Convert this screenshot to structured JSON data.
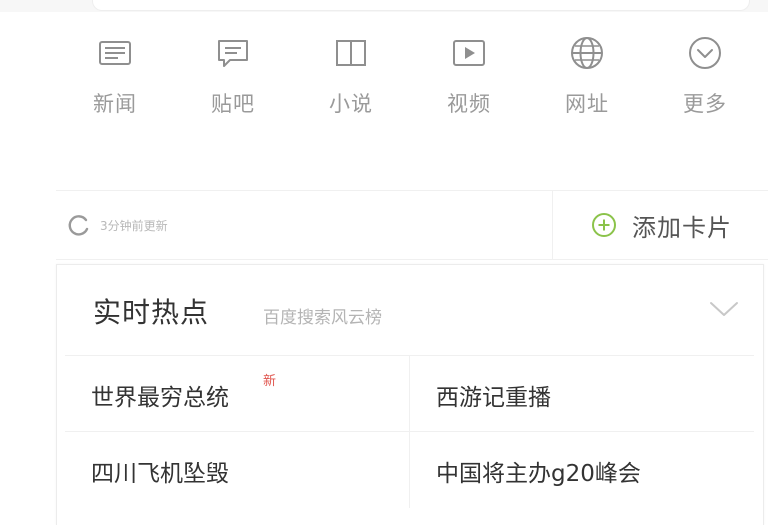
{
  "nav": {
    "items": [
      {
        "label": "新闻",
        "icon": "news-icon"
      },
      {
        "label": "贴吧",
        "icon": "tieba-icon"
      },
      {
        "label": "小说",
        "icon": "book-icon"
      },
      {
        "label": "视频",
        "icon": "video-icon"
      },
      {
        "label": "网址",
        "icon": "globe-icon"
      },
      {
        "label": "更多",
        "icon": "chevron-down-circle-icon"
      }
    ]
  },
  "update": {
    "status_text": "3分钟前更新",
    "refresh_icon": "refresh-icon"
  },
  "add_card": {
    "label": "添加卡片",
    "icon": "plus-circle-icon",
    "accent": "#8bc34a"
  },
  "hot_card": {
    "title": "实时热点",
    "subtitle": "百度搜索风云榜",
    "items": [
      {
        "text": "世界最穷总统",
        "badge": "新"
      },
      {
        "text": "西游记重播",
        "badge": ""
      },
      {
        "text": "四川飞机坠毁",
        "badge": ""
      },
      {
        "text": "中国将主办g20峰会",
        "badge": ""
      }
    ],
    "badge_color": "#e0554e"
  }
}
